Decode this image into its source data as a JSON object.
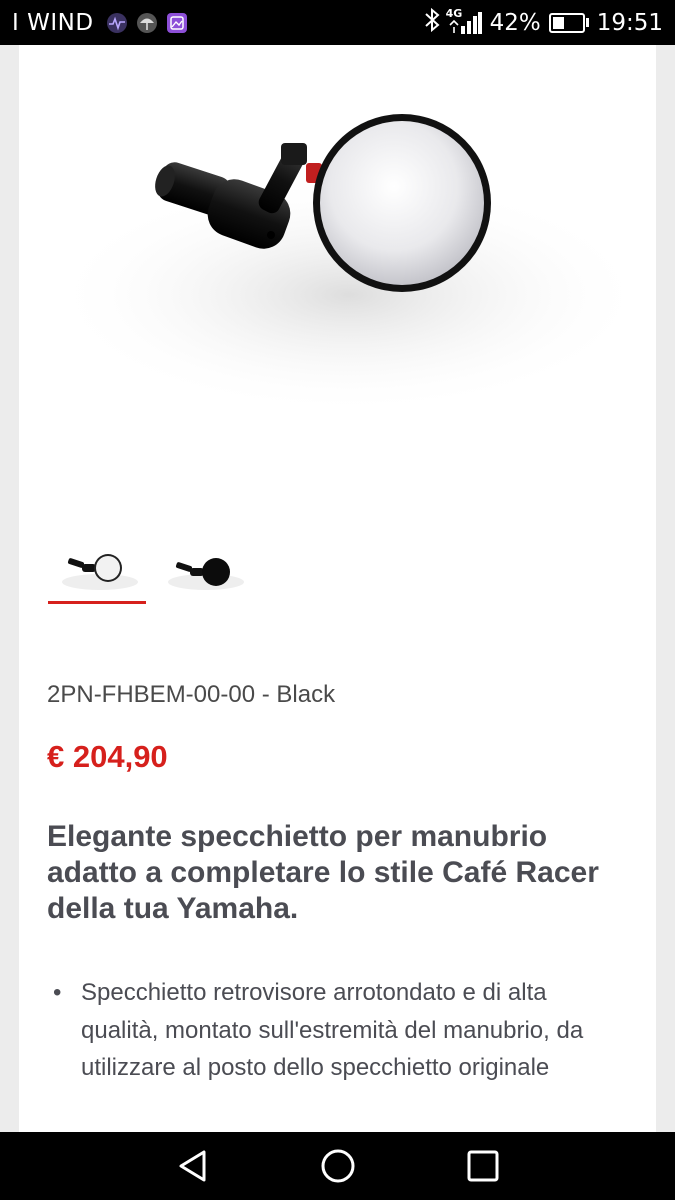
{
  "status_bar": {
    "carrier": "I WIND",
    "network": "4G",
    "battery_percent": "42%",
    "battery_level": 0.42,
    "time": "19:51",
    "icons": [
      "activity-icon",
      "umbrella-icon",
      "gallery-icon",
      "bluetooth-icon",
      "signal-icon",
      "battery-icon"
    ]
  },
  "product": {
    "sku_line": "2PN-FHBEM-00-00 - Black",
    "price": "€ 204,90",
    "headline": "Elegante specchietto per manubrio adatto a completare lo stile Café Racer della tua Yamaha.",
    "features": [
      "Specchietto retrovisore arrotondato e di alta qualità, montato sull'estremità del manubrio, da utilizzare al posto dello specchietto originale"
    ],
    "bullet": "•",
    "thumbnails": [
      {
        "variant": "silver-mirror",
        "active": true
      },
      {
        "variant": "black-mirror",
        "active": false
      }
    ],
    "accent_color": "#d6201c"
  },
  "nav_bar": {
    "buttons": [
      "back-icon",
      "home-icon",
      "recents-icon"
    ]
  }
}
